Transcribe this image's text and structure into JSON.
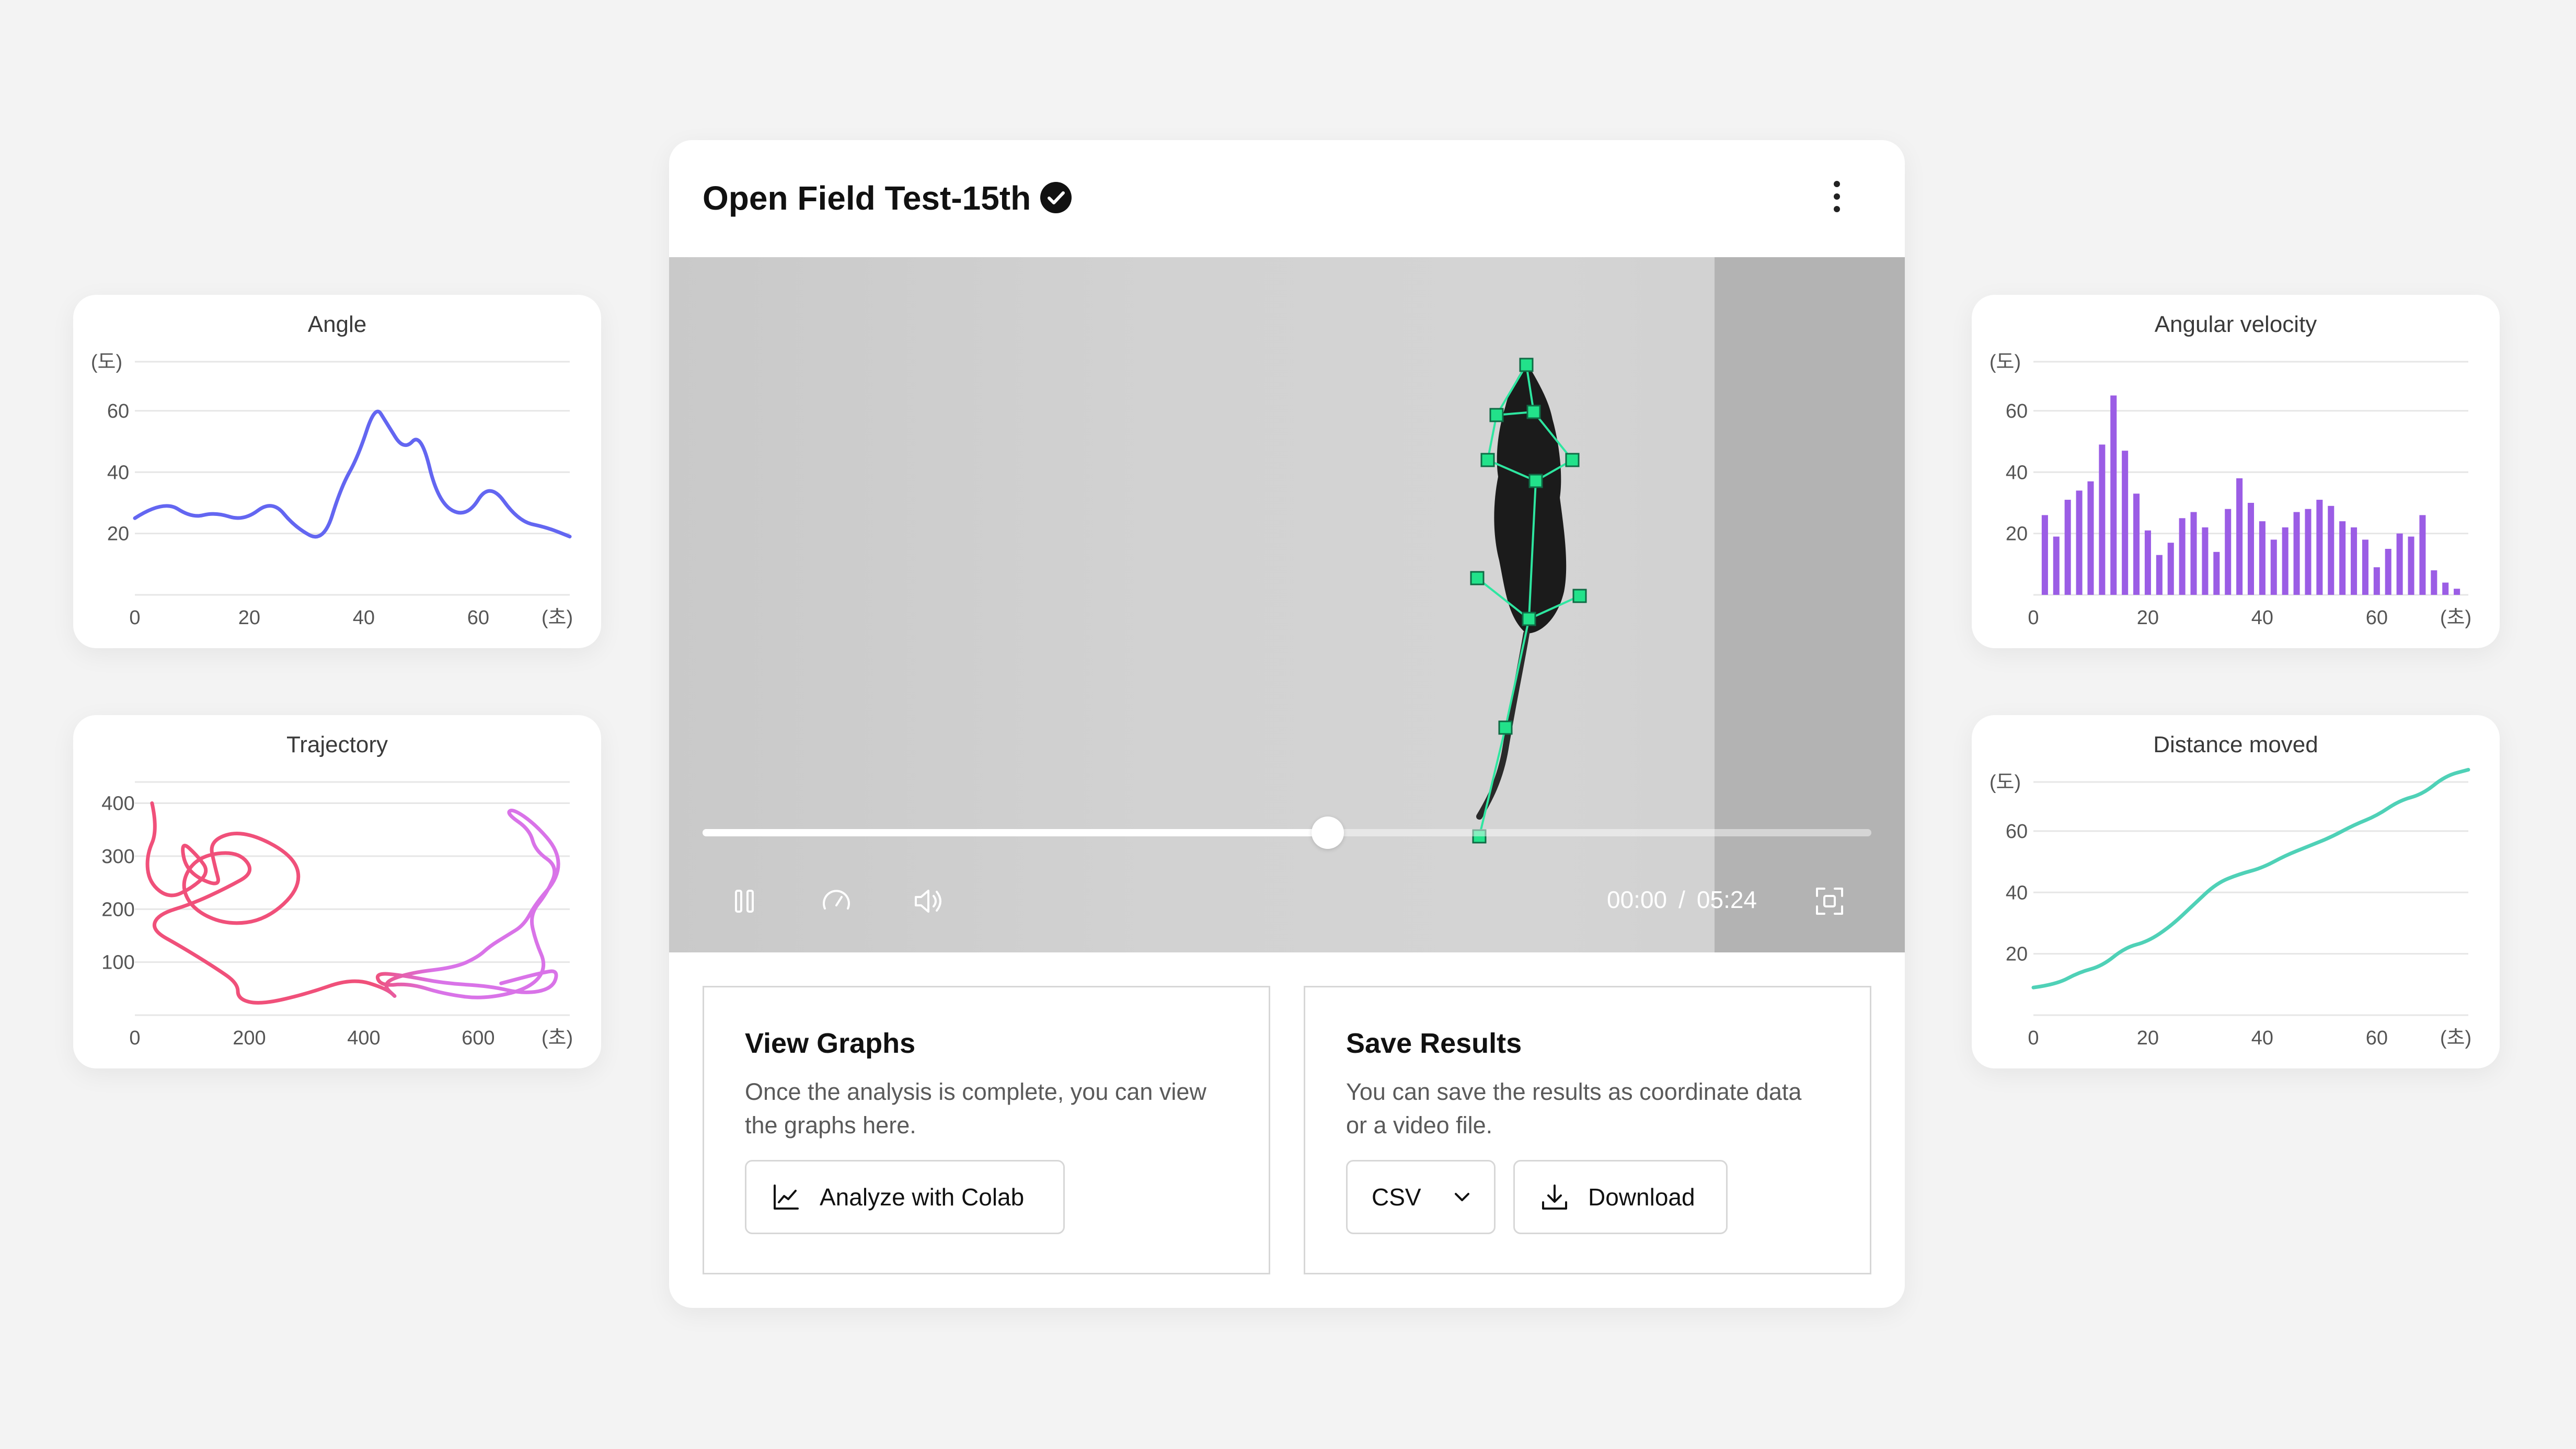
{
  "main": {
    "title": "Open Field Test-15th",
    "time_current": "00:00",
    "time_separator": "/",
    "time_total": "05:24",
    "progress_percent": 53.5,
    "view_graphs": {
      "title": "View Graphs",
      "description": "Once the analysis is complete, you can view the graphs here.",
      "button_label": "Analyze with Colab"
    },
    "save_results": {
      "title": "Save Results",
      "description": "You can save the results as coordinate data or a video file.",
      "format_value": "CSV",
      "download_label": "Download"
    }
  },
  "colors": {
    "angle": "#6366f1",
    "trajectory_start": "#f0507a",
    "trajectory_end": "#d973e8",
    "angular_velocity": "#9b5de5",
    "distance": "#4fd1b7",
    "keypoint": "#22e28a"
  },
  "icons": [
    "check-badge-icon",
    "more-vertical-icon",
    "pause-icon",
    "speed-icon",
    "volume-icon",
    "fullscreen-icon",
    "line-chart-icon",
    "chevron-down-icon",
    "download-icon"
  ],
  "chart_data": [
    {
      "type": "line",
      "title": "Angle",
      "ylabel": "(도)",
      "xlabel": "(초)",
      "xlim": [
        0,
        76
      ],
      "ylim": [
        0,
        76
      ],
      "xticks": [
        "0",
        "20",
        "40",
        "60"
      ],
      "yticks": [
        "20",
        "40",
        "60"
      ],
      "x": [
        0,
        5,
        10,
        14,
        19,
        24,
        28,
        33,
        36,
        39,
        42,
        44,
        47,
        50,
        53,
        58,
        62,
        67,
        72,
        76
      ],
      "y": [
        25,
        31,
        25,
        27,
        24,
        31,
        22,
        17,
        35,
        45,
        62,
        56,
        47,
        53,
        30,
        25,
        37,
        24,
        22,
        19
      ]
    },
    {
      "type": "line",
      "title": "Trajectory",
      "xlabel": "(초)",
      "xlim": [
        0,
        760
      ],
      "ylim": [
        0,
        440
      ],
      "xticks": [
        "0",
        "200",
        "400",
        "600"
      ],
      "yticks": [
        "100",
        "200",
        "300",
        "400"
      ],
      "x": [
        30,
        40,
        20,
        25,
        60,
        100,
        130,
        110,
        80,
        90,
        150,
        140,
        130,
        190,
        280,
        290,
        230,
        160,
        100,
        80,
        110,
        180,
        210,
        160,
        100,
        40,
        30,
        80,
        140,
        180,
        180,
        220,
        300,
        380,
        440,
        460,
        430,
        480,
        560,
        600,
        620,
        650,
        680,
        700,
        740,
        740,
        700,
        660,
        650,
        690,
        700,
        740,
        720,
        690,
        700,
        720,
        690,
        610,
        540,
        480,
        430,
        420,
        470,
        540,
        620,
        680,
        730,
        740,
        710,
        640
      ],
      "y": [
        400,
        350,
        300,
        250,
        220,
        240,
        270,
        300,
        330,
        270,
        240,
        280,
        330,
        350,
        300,
        240,
        180,
        170,
        200,
        250,
        300,
        310,
        270,
        240,
        210,
        190,
        160,
        130,
        90,
        60,
        30,
        20,
        40,
        70,
        50,
        30,
        60,
        80,
        90,
        110,
        130,
        150,
        170,
        210,
        260,
        310,
        360,
        390,
        380,
        350,
        310,
        280,
        230,
        190,
        140,
        90,
        50,
        30,
        40,
        60,
        55,
        80,
        75,
        60,
        55,
        40,
        50,
        85,
        80,
        60
      ]
    },
    {
      "type": "bar",
      "title": "Angular velocity",
      "ylabel": "(도)",
      "xlabel": "(초)",
      "xlim": [
        0,
        76
      ],
      "ylim": [
        0,
        76
      ],
      "xticks": [
        "0",
        "20",
        "40",
        "60"
      ],
      "yticks": [
        "20",
        "40",
        "60"
      ],
      "x": [
        2,
        4,
        6,
        8,
        10,
        12,
        14,
        16,
        18,
        20,
        22,
        24,
        26,
        28,
        30,
        32,
        34,
        36,
        38,
        40,
        42,
        44,
        46,
        48,
        50,
        52,
        54,
        56,
        58,
        60,
        62,
        64,
        66,
        68,
        70,
        72,
        74
      ],
      "values": [
        26,
        19,
        31,
        34,
        37,
        49,
        65,
        47,
        33,
        21,
        13,
        17,
        25,
        27,
        22,
        14,
        28,
        38,
        30,
        24,
        18,
        22,
        27,
        28,
        31,
        29,
        24,
        22,
        18,
        9,
        15,
        20,
        19,
        26,
        8,
        4,
        2
      ]
    },
    {
      "type": "line",
      "title": "Distance moved",
      "ylabel": "(도)",
      "xlabel": "(초)",
      "xlim": [
        0,
        76
      ],
      "ylim": [
        0,
        76
      ],
      "xticks": [
        "0",
        "20",
        "40",
        "60"
      ],
      "yticks": [
        "20",
        "40",
        "60"
      ],
      "x": [
        0,
        4,
        8,
        12,
        16,
        20,
        24,
        28,
        32,
        36,
        40,
        44,
        48,
        52,
        56,
        60,
        64,
        68,
        72,
        76
      ],
      "y": [
        9,
        10,
        14,
        16,
        22,
        24,
        29,
        36,
        43,
        46,
        48,
        52,
        55,
        58,
        62,
        65,
        70,
        72,
        78,
        80
      ]
    }
  ]
}
